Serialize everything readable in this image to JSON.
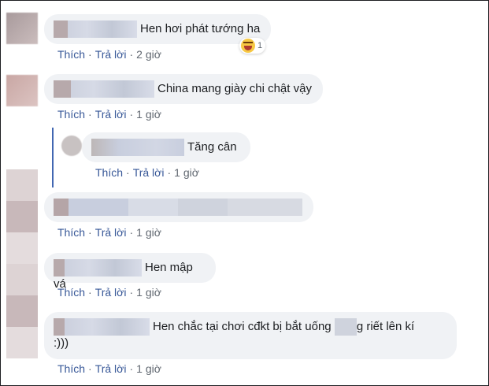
{
  "comments": [
    {
      "text": "Hen hơi phát tướng ha",
      "time": "2 giờ",
      "reaction_count": "1"
    },
    {
      "text": "China mang giày chi chật vậy",
      "time": "1 giờ"
    },
    {
      "text": "Tăng cân",
      "time": "1 giờ"
    },
    {
      "text": "",
      "time": "1 giờ"
    },
    {
      "text": "Hen mập vá",
      "time": "1 giờ"
    },
    {
      "text_before": "Hen chắc tại chơi cđkt bị bắt uống",
      "text_after": "g riết lên kí",
      "text_line2": ":)))",
      "time": "1 giờ"
    }
  ],
  "labels": {
    "like": "Thích",
    "reply": "Trả lời",
    "dot": "·"
  },
  "icons": {
    "reaction": "laughing-emoji-icon"
  }
}
